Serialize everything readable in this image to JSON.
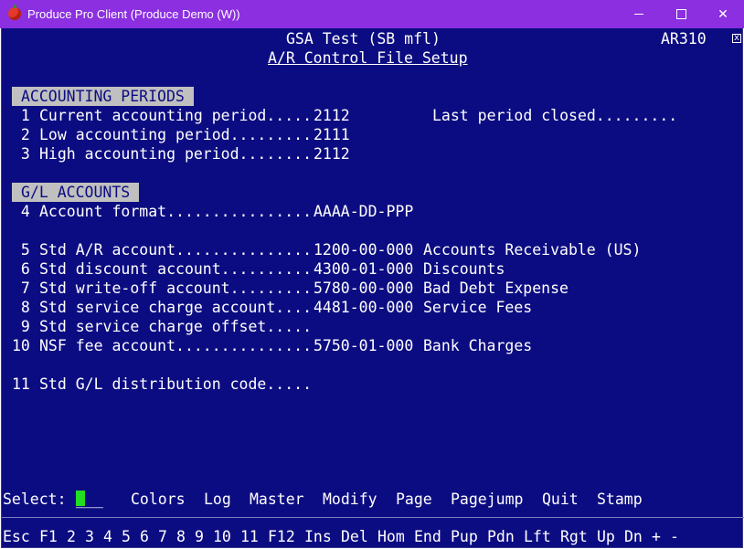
{
  "window": {
    "title": "Produce Pro Client (Produce Demo (W))",
    "icon": "tomato-icon",
    "buttons": [
      "minimize",
      "maximize",
      "close"
    ],
    "close_glyph": "✕"
  },
  "header": {
    "company": "GSA Test (SB mfl)",
    "program_code": "AR310",
    "screen_title": "A/R Control File Setup",
    "close_box": "x"
  },
  "sections": {
    "periods_title": "ACCOUNTING PERIODS",
    "gl_title": "G/L ACCOUNTS"
  },
  "fields": [
    {
      "num": " 1",
      "label": "Current accounting period.....",
      "value": "2112",
      "desc": ""
    },
    {
      "num": " 2",
      "label": "Low accounting period.........",
      "value": "2111",
      "desc": ""
    },
    {
      "num": " 3",
      "label": "High accounting period........",
      "value": "2112",
      "desc": ""
    },
    {
      "num": " 4",
      "label": "Account format................",
      "value": "AAAA-DD-PPP",
      "desc": ""
    },
    {
      "num": " 5",
      "label": "Std A/R account...............",
      "value": "1200-00-000",
      "desc": "Accounts Receivable (US)"
    },
    {
      "num": " 6",
      "label": "Std discount account..........",
      "value": "4300-01-000",
      "desc": "Discounts"
    },
    {
      "num": " 7",
      "label": "Std write-off account.........",
      "value": "5780-00-000",
      "desc": "Bad Debt Expense"
    },
    {
      "num": " 8",
      "label": "Std service charge account....",
      "value": "4481-00-000",
      "desc": "Service Fees"
    },
    {
      "num": " 9",
      "label": "Std service charge offset.....",
      "value": "",
      "desc": ""
    },
    {
      "num": "10",
      "label": "NSF fee account...............",
      "value": "5750-01-000",
      "desc": "Bank Charges"
    },
    {
      "num": "11",
      "label": "Std G/L distribution code.....",
      "value": "",
      "desc": ""
    }
  ],
  "last_period": {
    "label": "Last period closed.........",
    "value": ""
  },
  "select": {
    "label": "Select:",
    "input_value": "___",
    "options": [
      "Colors",
      "Log",
      "Master",
      "Modify",
      "Page",
      "Pagejump",
      "Quit",
      "Stamp"
    ]
  },
  "function_keys": [
    "Esc",
    "F1",
    "2",
    "3",
    "4",
    "5",
    "6",
    "7",
    "8",
    "9",
    "10",
    "11",
    "F12",
    "Ins",
    "Del",
    "Hom",
    "End",
    "Pup",
    "Pdn",
    "Lft",
    "Rgt",
    "Up",
    "Dn",
    "+",
    "-"
  ],
  "colors": {
    "titlebar": "#8b2fe0",
    "screen_bg": "#0c0c82",
    "text": "#ffffff",
    "section_bar": "#c0c0c0",
    "cursor": "#22dd22"
  }
}
